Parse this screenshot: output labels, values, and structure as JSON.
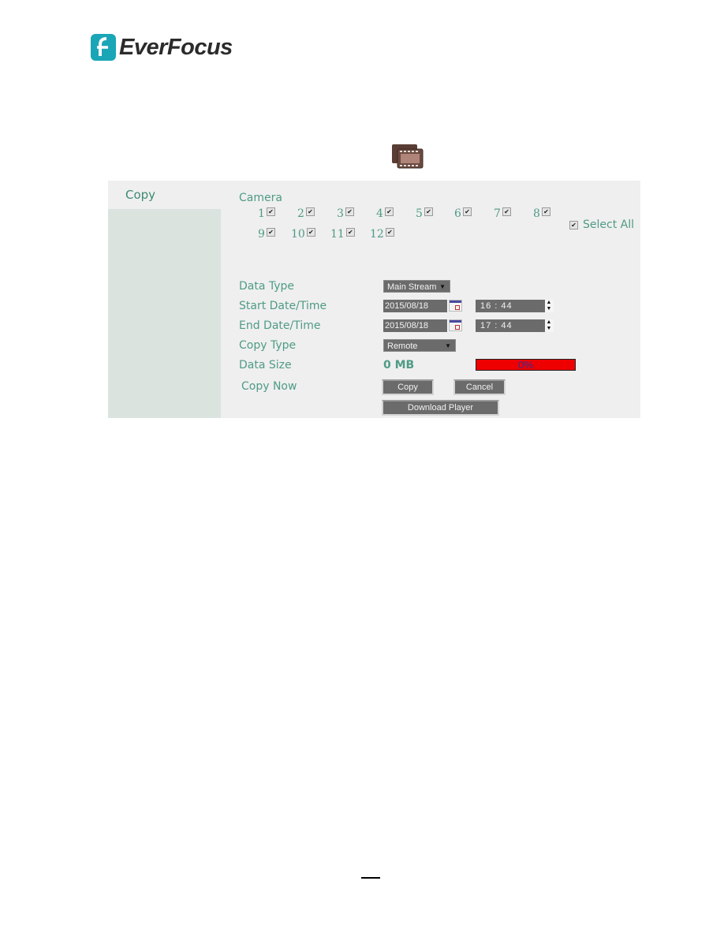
{
  "brand": {
    "name": "EverFocus",
    "accent_color": "#1aa6b7"
  },
  "icons": {
    "logo": "everfocus-logo-icon",
    "copy_toolbar": "film-strip-icon"
  },
  "sidebar": {
    "items": [
      {
        "label": "Copy",
        "active": true
      }
    ]
  },
  "copy_form": {
    "camera_label": "Camera",
    "cameras": [
      {
        "label": "1",
        "checked": true
      },
      {
        "label": "2",
        "checked": true
      },
      {
        "label": "3",
        "checked": true
      },
      {
        "label": "4",
        "checked": true
      },
      {
        "label": "5",
        "checked": true
      },
      {
        "label": "6",
        "checked": true
      },
      {
        "label": "7",
        "checked": true
      },
      {
        "label": "8",
        "checked": true
      },
      {
        "label": "9",
        "checked": true
      },
      {
        "label": "10",
        "checked": true
      },
      {
        "label": "11",
        "checked": true
      },
      {
        "label": "12",
        "checked": true
      }
    ],
    "select_all": {
      "label": "Select All",
      "checked": true
    },
    "check_glyph": "✔",
    "data_type": {
      "label": "Data Type",
      "value": "Main Stream"
    },
    "start": {
      "label": "Start Date/Time",
      "date": "2015/08/18",
      "hour": "16",
      "minute": "44",
      "time_display": "16 : 44"
    },
    "end": {
      "label": "End Date/Time",
      "date": "2015/08/18",
      "hour": "17",
      "minute": "44",
      "time_display": "17 : 44"
    },
    "copy_type": {
      "label": "Copy Type",
      "value": "Remote"
    },
    "data_size": {
      "label": "Data Size",
      "value": "0 MB"
    },
    "progress": {
      "percent": 0,
      "text": "0%",
      "color": "#ee0000"
    },
    "copy_now": {
      "label": "Copy Now"
    },
    "buttons": {
      "copy": "Copy",
      "cancel": "Cancel",
      "download_player": "Download Player"
    },
    "dropdown_arrow": "▼",
    "spin_up": "▲",
    "spin_down": "▼"
  }
}
